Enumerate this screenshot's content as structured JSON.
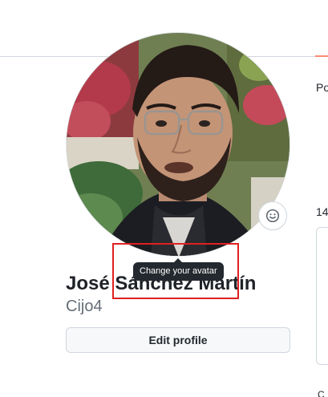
{
  "profile": {
    "display_name": "José Sánchez Martín",
    "username": "Cijo4",
    "edit_profile_label": "Edit profile"
  },
  "avatar": {
    "tooltip": "Change your avatar",
    "status_icon": "smiley-icon"
  },
  "side": {
    "nav_partial": "Po",
    "count_partial": "14",
    "bottom_partial": "C"
  },
  "colors": {
    "accent_tab": "#fd8c73",
    "tooltip_bg": "#24292f",
    "highlight_box": "#e02020",
    "button_bg": "#f6f8fa",
    "border": "#d0d7de",
    "muted_text": "#656d76"
  }
}
